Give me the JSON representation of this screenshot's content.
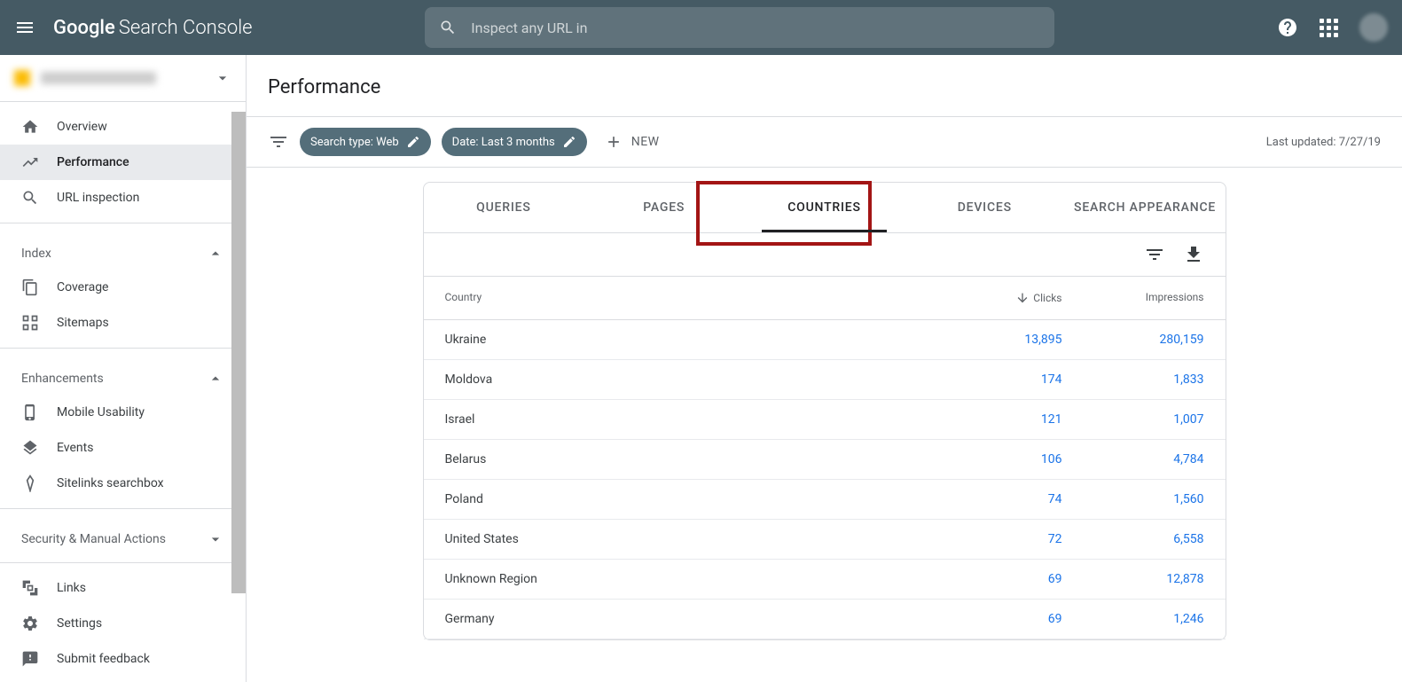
{
  "header": {
    "logo_google": "Google",
    "logo_sc": "Search Console",
    "search_placeholder": "Inspect any URL in"
  },
  "sidebar": {
    "items": [
      {
        "label": "Overview",
        "icon": "home"
      },
      {
        "label": "Performance",
        "icon": "trend",
        "active": true
      },
      {
        "label": "URL inspection",
        "icon": "search"
      }
    ],
    "section_index": "Index",
    "index_items": [
      {
        "label": "Coverage",
        "icon": "copy"
      },
      {
        "label": "Sitemaps",
        "icon": "sitemap"
      }
    ],
    "section_enhancements": "Enhancements",
    "enhancement_items": [
      {
        "label": "Mobile Usability",
        "icon": "mobile"
      },
      {
        "label": "Events",
        "icon": "layers"
      },
      {
        "label": "Sitelinks searchbox",
        "icon": "diamond"
      }
    ],
    "section_security": "Security & Manual Actions",
    "bottom_items": [
      {
        "label": "Links",
        "icon": "links"
      },
      {
        "label": "Settings",
        "icon": "gear"
      },
      {
        "label": "Submit feedback",
        "icon": "feedback"
      }
    ]
  },
  "page": {
    "title": "Performance",
    "filter_search_type": "Search type: Web",
    "filter_date": "Date: Last 3 months",
    "new_label": "NEW",
    "last_updated": "Last updated: 7/27/19"
  },
  "tabs": [
    "QUERIES",
    "PAGES",
    "COUNTRIES",
    "DEVICES",
    "SEARCH APPEARANCE"
  ],
  "active_tab": "COUNTRIES",
  "table": {
    "headers": {
      "country": "Country",
      "clicks": "Clicks",
      "impressions": "Impressions"
    },
    "rows": [
      {
        "country": "Ukraine",
        "clicks": "13,895",
        "impressions": "280,159"
      },
      {
        "country": "Moldova",
        "clicks": "174",
        "impressions": "1,833"
      },
      {
        "country": "Israel",
        "clicks": "121",
        "impressions": "1,007"
      },
      {
        "country": "Belarus",
        "clicks": "106",
        "impressions": "4,784"
      },
      {
        "country": "Poland",
        "clicks": "74",
        "impressions": "1,560"
      },
      {
        "country": "United States",
        "clicks": "72",
        "impressions": "6,558"
      },
      {
        "country": "Unknown Region",
        "clicks": "69",
        "impressions": "12,878"
      },
      {
        "country": "Germany",
        "clicks": "69",
        "impressions": "1,246"
      }
    ]
  }
}
